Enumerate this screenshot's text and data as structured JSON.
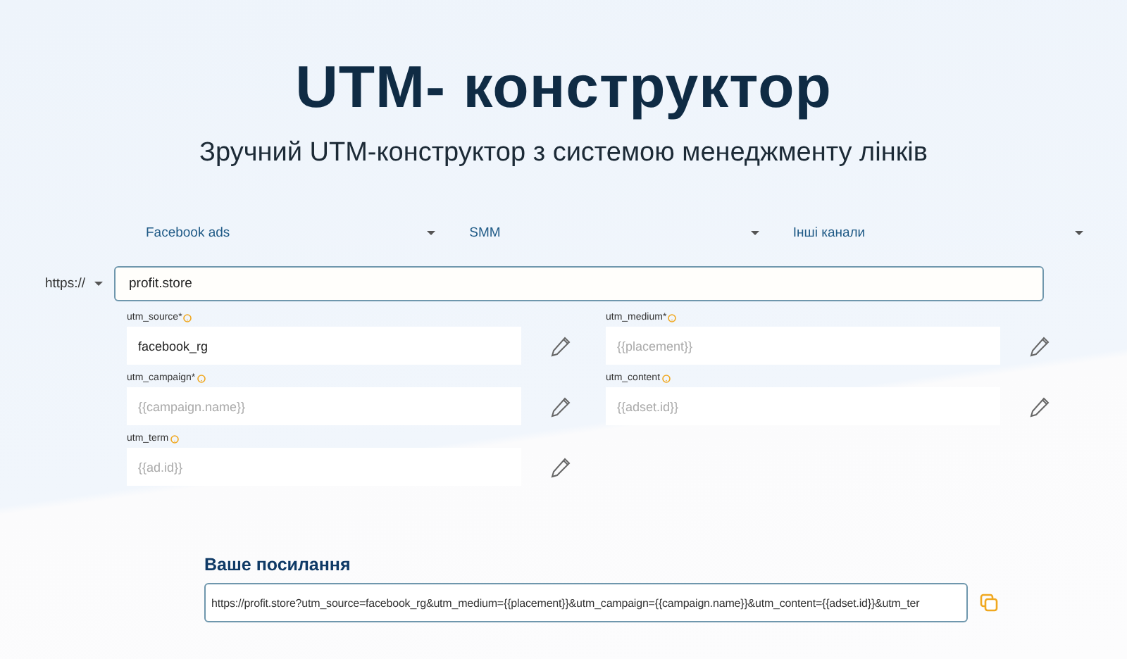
{
  "header": {
    "title": "UTM- конструктор",
    "subtitle": "Зручний UTM-конструктор з системою менеджменту лінків"
  },
  "channels": [
    {
      "label": "Facebook ads"
    },
    {
      "label": "SMM"
    },
    {
      "label": "Інші канали"
    }
  ],
  "url": {
    "protocol": "https://",
    "value": "profit.store"
  },
  "params": [
    {
      "label": "utm_source*",
      "value": "facebook_rg"
    },
    {
      "label": "utm_medium*",
      "placeholder": "{{placement}}"
    },
    {
      "label": "utm_campaign*",
      "placeholder": "{{campaign.name}}"
    },
    {
      "label": "utm_content",
      "placeholder": "{{adset.id}}"
    },
    {
      "label": "utm_term",
      "placeholder": "{{ad.id}}"
    }
  ],
  "result": {
    "label": "Ваше посилання",
    "value": "https://profit.store?utm_source=facebook_rg&utm_medium={{placement}}&utm_campaign={{campaign.name}}&utm_content={{adset.id}}&utm_ter"
  }
}
